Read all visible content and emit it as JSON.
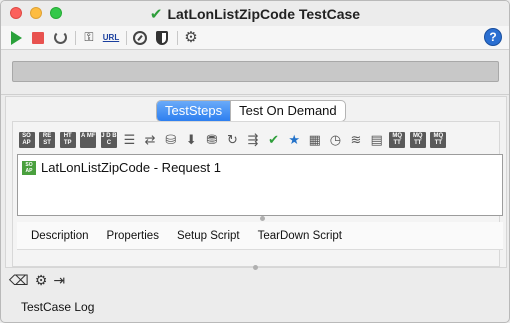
{
  "window": {
    "title": "LatLonListZipCode TestCase",
    "title_icon": "check-icon"
  },
  "toolbar": {
    "items": [
      {
        "name": "run",
        "icon": "play-icon"
      },
      {
        "name": "cancel",
        "icon": "stop-icon"
      },
      {
        "name": "loop",
        "icon": "loop-icon"
      },
      {
        "name": "credentials",
        "icon": "key-icon"
      },
      {
        "name": "endpoint",
        "icon": "url-icon",
        "label": "URL"
      },
      {
        "name": "load-test",
        "icon": "gauge-icon"
      },
      {
        "name": "security-test",
        "icon": "shield-icon"
      },
      {
        "name": "options",
        "icon": "gear-icon"
      }
    ],
    "help": "?"
  },
  "progress": {
    "value": 0
  },
  "tabs": [
    {
      "label": "TestSteps",
      "active": true
    },
    {
      "label": "Test On Demand",
      "active": false
    }
  ],
  "step_toolbar": [
    {
      "icon": "soap-request-icon",
      "text": "SO AP"
    },
    {
      "icon": "rest-request-icon",
      "text": "RE ST"
    },
    {
      "icon": "http-request-icon",
      "text": "HT TP"
    },
    {
      "icon": "amf-request-icon",
      "text": "A MF"
    },
    {
      "icon": "jdbc-request-icon",
      "text": "J D B C"
    },
    {
      "icon": "property-list-icon",
      "glyph": "☰"
    },
    {
      "icon": "property-transfer-icon",
      "glyph": "⇄"
    },
    {
      "icon": "datasource-icon",
      "glyph": "⛁"
    },
    {
      "icon": "datasink-icon",
      "glyph": "⬇"
    },
    {
      "icon": "database-icon",
      "glyph": "⛃"
    },
    {
      "icon": "loop-step-icon",
      "glyph": "↻"
    },
    {
      "icon": "goto-icon",
      "glyph": "⇶"
    },
    {
      "icon": "assertion-icon",
      "glyph": "✔"
    },
    {
      "icon": "star-icon",
      "glyph": "★"
    },
    {
      "icon": "grid-icon",
      "glyph": "▦"
    },
    {
      "icon": "clock-icon",
      "glyph": "◷"
    },
    {
      "icon": "script-icon",
      "glyph": "≋"
    },
    {
      "icon": "comment-icon",
      "glyph": "▤"
    },
    {
      "icon": "mq-icon-1",
      "text": "MQ TT"
    },
    {
      "icon": "mq-icon-2",
      "text": "MQ TT"
    },
    {
      "icon": "mq-icon-3",
      "text": "MQ TT"
    }
  ],
  "steps": [
    {
      "label": "LatLonListZipCode - Request 1",
      "icon": "soap-request-icon"
    }
  ],
  "bottom_tabs": [
    "Description",
    "Properties",
    "Setup Script",
    "TearDown Script"
  ],
  "footer": {
    "icons": [
      "eraser-icon",
      "gear-icon",
      "export-icon"
    ],
    "log_label": "TestCase Log"
  }
}
